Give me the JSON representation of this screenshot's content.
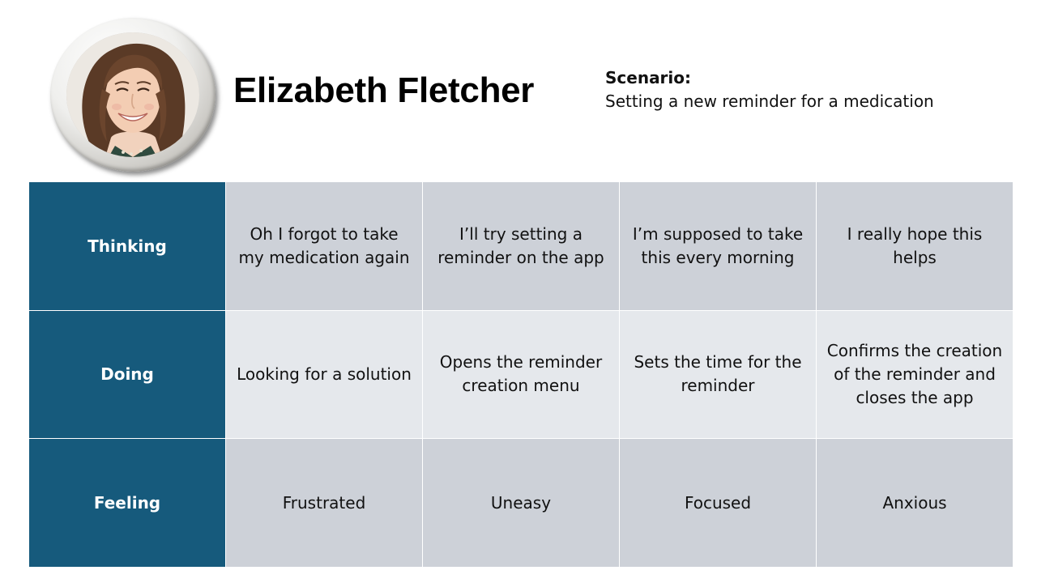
{
  "persona": {
    "name": "Elizabeth Fletcher",
    "avatar_icon": "persona-photo"
  },
  "scenario": {
    "label": "Scenario:",
    "text": "Setting a new reminder for a medication"
  },
  "colors": {
    "row_header_bg": "#165a7c",
    "cell_dark_bg": "#cdd1d8",
    "cell_light_bg": "#e5e8ec"
  },
  "journey": {
    "rows": [
      {
        "label": "Thinking",
        "cells": [
          "Oh I forgot to take my medication again",
          "I’ll try setting a reminder on the app",
          "I’m supposed to take this every morning",
          "I really hope this helps"
        ]
      },
      {
        "label": "Doing",
        "cells": [
          "Looking for a solution",
          "Opens the reminder creation menu",
          "Sets the time for the reminder",
          "Confirms the creation of the reminder and closes the app"
        ]
      },
      {
        "label": "Feeling",
        "cells": [
          "Frustrated",
          "Uneasy",
          "Focused",
          "Anxious"
        ]
      }
    ]
  }
}
